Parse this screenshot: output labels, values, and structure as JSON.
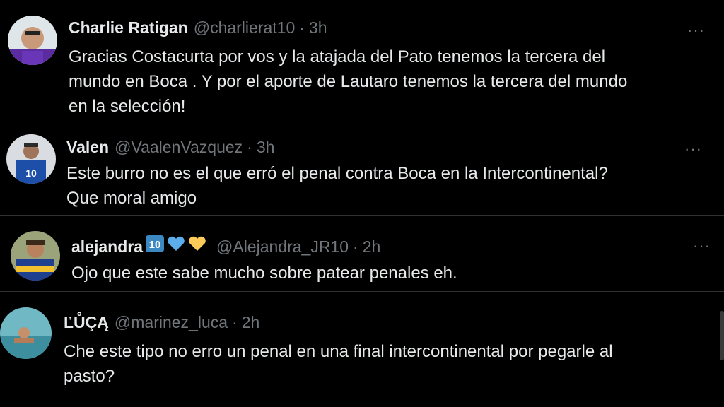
{
  "tweets": [
    {
      "name": "Charlie Ratigan",
      "handle": "@charlierat10",
      "separator": "·",
      "time": "3h",
      "text": "Gracias Costacurta por vos y la atajada del Pato tenemos la tercera del\nmundo en Boca . Y por el aporte de Lautaro tenemos la tercera del mundo\nen la selección!",
      "more": "···"
    },
    {
      "name": "Valen",
      "handle": "@VaalenVazquez",
      "separator": "·",
      "time": "3h",
      "text": "Este burro no es el que erró el penal contra Boca en la Intercontinental?\nQue moral amigo",
      "more": "···"
    },
    {
      "name": "alejandra",
      "handle": "@Alejandra_JR10",
      "separator": "·",
      "time": "2h",
      "text": "Ojo que este sabe mucho sobre patear penales eh.",
      "more": "···",
      "name_emojis": [
        "keycap-10-emoji",
        "blue-heart-emoji",
        "yellow-heart-emoji"
      ]
    },
    {
      "name": "ĽŮÇĄ",
      "handle": "@marinez_luca",
      "separator": "·",
      "time": "2h",
      "text": "Che este tipo no erro un penal en una final intercontinental por pegarle al\npasto?",
      "more": "···"
    }
  ],
  "colors": {
    "background": "#000000",
    "text": "#e7e9ea",
    "muted": "#71767b",
    "divider": "#2f3336"
  }
}
